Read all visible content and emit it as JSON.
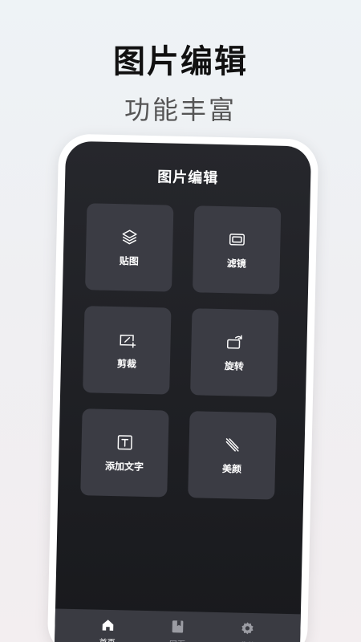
{
  "promo": {
    "title": "图片编辑",
    "subtitle": "功能丰富"
  },
  "app": {
    "title": "图片编辑"
  },
  "tools": [
    {
      "label": "贴图",
      "icon": "layers-icon"
    },
    {
      "label": "滤镜",
      "icon": "filter-frame-icon"
    },
    {
      "label": "剪裁",
      "icon": "crop-icon"
    },
    {
      "label": "旋转",
      "icon": "rotate-icon"
    },
    {
      "label": "添加文字",
      "icon": "text-box-icon"
    },
    {
      "label": "美颜",
      "icon": "beauty-stripes-icon"
    }
  ],
  "nav": [
    {
      "label": "首页",
      "icon": "home-icon",
      "active": true
    },
    {
      "label": "网页",
      "icon": "book-icon",
      "active": false
    },
    {
      "label": "我的",
      "icon": "gear-icon",
      "active": false
    }
  ],
  "colors": {
    "screen_bg": "#1c1d21",
    "tile_bg": "#3b3c44",
    "nav_bg": "#3a3b42",
    "active_text": "#ffffff",
    "inactive_text": "#9b9ca3"
  }
}
